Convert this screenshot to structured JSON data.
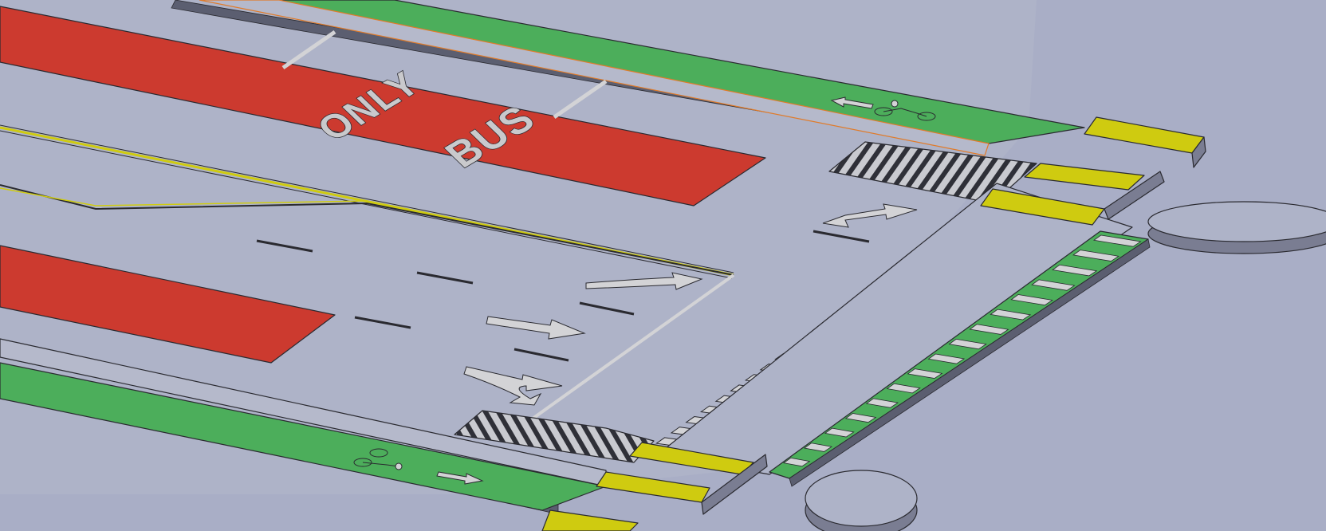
{
  "scene": {
    "background": "#a9aec6",
    "road_surface": "#aeb3c8",
    "colors": {
      "bus_lane": "#cc3a2f",
      "bike_lane": "#4cae5b",
      "curb_yellow": "#cfcb10",
      "marking": "#d3d3d6",
      "side_shadow": "#6e7186"
    },
    "bus_lane_marking": {
      "word_1": "ONLY",
      "word_2": "BUS"
    },
    "lane_arrows": [
      "right-turn-arrow",
      "straight-arrow",
      "straight-or-right-arrow",
      "left-arrow"
    ],
    "bike_lane_symbols": [
      "bicycle-symbol-north",
      "bicycle-symbol-south"
    ]
  }
}
